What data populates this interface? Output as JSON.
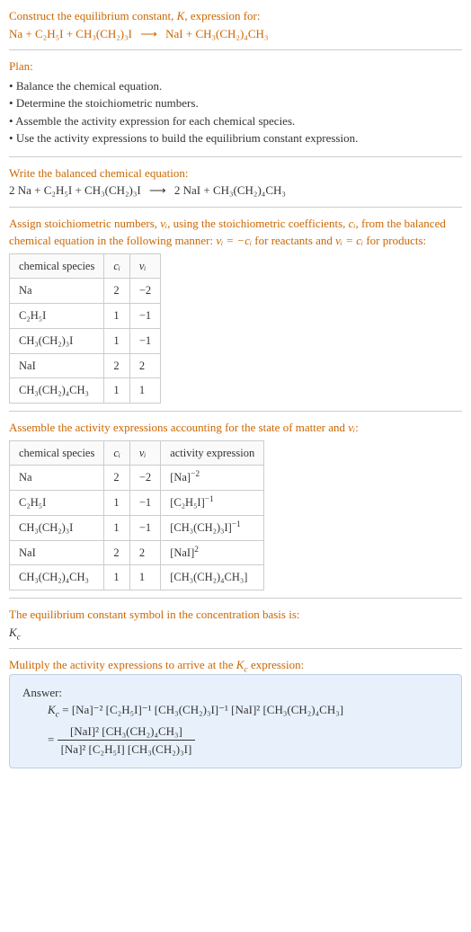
{
  "title_a": "Construct the equilibrium constant, ",
  "title_k": "K",
  "title_b": ", expression for:",
  "eq1": {
    "lhs": "Na + C₂H₅I + CH₃(CH₂)₃I",
    "arrow": "⟶",
    "rhs": "NaI + CH₃(CH₂)₄CH₃"
  },
  "plan_label": "Plan:",
  "plan": [
    "Balance the chemical equation.",
    "Determine the stoichiometric numbers.",
    "Assemble the activity expression for each chemical species.",
    "Use the activity expressions to build the equilibrium constant expression."
  ],
  "balanced_label": "Write the balanced chemical equation:",
  "eq2": {
    "lhs": "2 Na + C₂H₅I + CH₃(CH₂)₃I",
    "arrow": "⟶",
    "rhs": "2 NaI + CH₃(CH₂)₄CH₃"
  },
  "assign1_a": "Assign stoichiometric numbers, ",
  "assign1_nu": "νᵢ",
  "assign1_b": ", using the stoichiometric coefficients, ",
  "assign1_c": "cᵢ",
  "assign1_d": ", from the balanced chemical equation in the following manner: ",
  "assign1_e": "νᵢ = −cᵢ",
  "assign1_f": " for reactants and ",
  "assign1_g": "νᵢ = cᵢ",
  "assign1_h": " for products:",
  "table1": {
    "headers": [
      "chemical species",
      "cᵢ",
      "νᵢ"
    ],
    "rows": [
      [
        "Na",
        "2",
        "−2"
      ],
      [
        "C₂H₅I",
        "1",
        "−1"
      ],
      [
        "CH₃(CH₂)₃I",
        "1",
        "−1"
      ],
      [
        "NaI",
        "2",
        "2"
      ],
      [
        "CH₃(CH₂)₄CH₃",
        "1",
        "1"
      ]
    ]
  },
  "assemble_a": "Assemble the activity expressions accounting for the state of matter and ",
  "assemble_nu": "νᵢ",
  "assemble_b": ":",
  "table2": {
    "headers": [
      "chemical species",
      "cᵢ",
      "νᵢ",
      "activity expression"
    ],
    "rows": [
      {
        "sp": "Na",
        "c": "2",
        "nu": "−2",
        "base": "[Na]",
        "exp": "−2"
      },
      {
        "sp": "C₂H₅I",
        "c": "1",
        "nu": "−1",
        "base": "[C₂H₅I]",
        "exp": "−1"
      },
      {
        "sp": "CH₃(CH₂)₃I",
        "c": "1",
        "nu": "−1",
        "base": "[CH₃(CH₂)₃I]",
        "exp": "−1"
      },
      {
        "sp": "NaI",
        "c": "2",
        "nu": "2",
        "base": "[NaI]",
        "exp": "2"
      },
      {
        "sp": "CH₃(CH₂)₄CH₃",
        "c": "1",
        "nu": "1",
        "base": "[CH₃(CH₂)₄CH₃]",
        "exp": ""
      }
    ]
  },
  "eqconst_label": "The equilibrium constant symbol in the concentration basis is:",
  "eqconst_symbol_k": "K",
  "eqconst_symbol_c": "c",
  "multiply1_a": "Mulitply the activity expressions to arrive at the ",
  "multiply1_b": " expression:",
  "answer_label": "Answer:",
  "answer": {
    "k": "K",
    "c": "c",
    "line1": "= [Na]⁻² [C₂H₅I]⁻¹ [CH₃(CH₂)₃I]⁻¹ [NaI]² [CH₃(CH₂)₄CH₃]",
    "frac_num": "[NaI]² [CH₃(CH₂)₄CH₃]",
    "frac_den": "[Na]² [C₂H₅I] [CH₃(CH₂)₃I]"
  }
}
